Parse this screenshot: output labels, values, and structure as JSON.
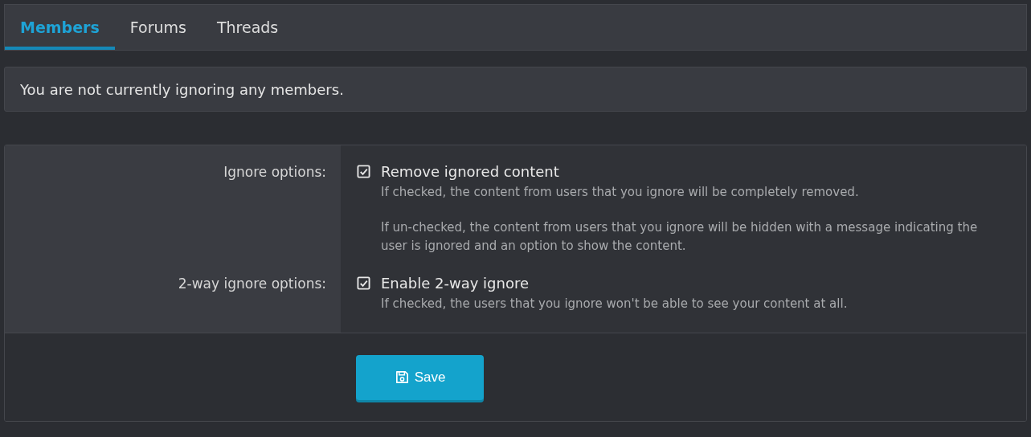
{
  "tabs": [
    {
      "label": "Members",
      "selected": true
    },
    {
      "label": "Forums",
      "selected": false
    },
    {
      "label": "Threads",
      "selected": false
    }
  ],
  "notice": "You are not currently ignoring any members.",
  "options": [
    {
      "label": "Ignore options:",
      "checkbox": "Remove ignored content",
      "checked": true,
      "hint": [
        "If checked, the content from users that you ignore will be completely removed.",
        "If un-checked, the content from users that you ignore will be hidden with a message indicating the user is ignored and an option to show the content."
      ]
    },
    {
      "label": "2-way ignore options:",
      "checkbox": "Enable 2-way ignore",
      "checked": true,
      "hint": [
        "If checked, the users that you ignore won't be able to see your content at all."
      ]
    }
  ],
  "save_button": "Save"
}
